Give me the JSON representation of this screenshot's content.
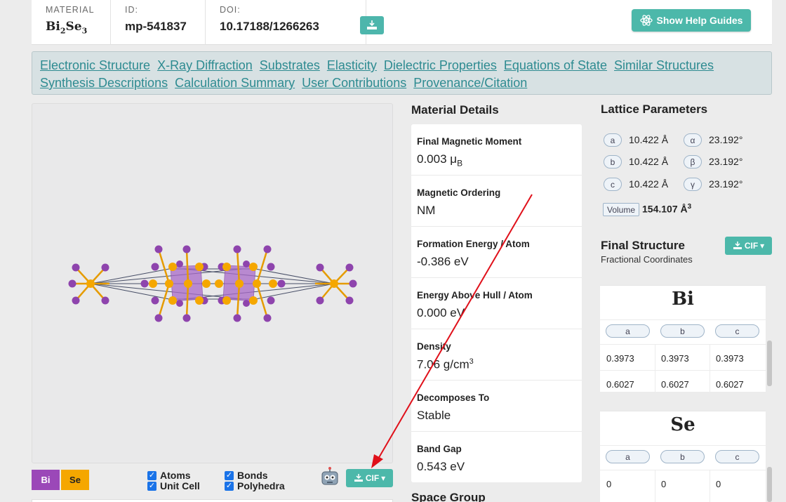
{
  "header": {
    "material_label": "MATERIAL",
    "formula_main": "Bi",
    "formula_sub1": "2",
    "formula_mid": "Se",
    "formula_sub2": "3",
    "id_label": "ID:",
    "id_value": "mp-541837",
    "doi_label": "DOI:",
    "doi_value": "10.17188/1266263",
    "help_label": "Show Help Guides"
  },
  "nav": {
    "links": [
      "Electronic Structure",
      "X-Ray Diffraction",
      "Substrates",
      "Elasticity",
      "Dielectric Properties",
      "Equations of State",
      "Similar Structures",
      "Synthesis Descriptions",
      "Calculation Summary",
      "User Contributions",
      "Provenance/Citation"
    ]
  },
  "viewer": {
    "elements": [
      {
        "label": "Bi",
        "color": "#9b48b8"
      },
      {
        "label": "Se",
        "color": "#f5a700"
      }
    ],
    "checks": {
      "atoms": "Atoms",
      "unit_cell": "Unit Cell",
      "bonds": "Bonds",
      "polyhedra": "Polyhedra"
    },
    "cif_label": "CIF"
  },
  "details": {
    "title": "Material Details",
    "rows": [
      {
        "label": "Final Magnetic Moment",
        "value": "0.003 μ",
        "sub": "B"
      },
      {
        "label": "Magnetic Ordering",
        "value": "NM"
      },
      {
        "label": "Formation Energy / Atom",
        "value": "-0.386 eV"
      },
      {
        "label": "Energy Above Hull / Atom",
        "value": "0.000 eV"
      },
      {
        "label": "Density",
        "value": "7.06 g/cm",
        "sup": "3"
      },
      {
        "label": "Decomposes To",
        "value": "Stable"
      },
      {
        "label": "Band Gap",
        "value": "0.543 eV"
      }
    ],
    "space_group_title": "Space Group"
  },
  "lattice": {
    "title": "Lattice Parameters",
    "params": [
      {
        "key": "a",
        "value": "10.422 Å"
      },
      {
        "key": "b",
        "value": "10.422 Å"
      },
      {
        "key": "c",
        "value": "10.422 Å"
      }
    ],
    "angles": [
      {
        "key": "α",
        "value": "23.192°"
      },
      {
        "key": "β",
        "value": "23.192°"
      },
      {
        "key": "γ",
        "value": "23.192°"
      }
    ],
    "volume_label": "Volume",
    "volume_value": "154.107 Å",
    "volume_sup": "3"
  },
  "final_structure": {
    "title": "Final Structure",
    "subtitle": "Fractional Coordinates",
    "cif_label": "CIF",
    "headers": [
      "a",
      "b",
      "c"
    ],
    "bi": {
      "element": "Bi",
      "rows": [
        [
          "0.3973",
          "0.3973",
          "0.3973"
        ],
        [
          "0.6027",
          "0.6027",
          "0.6027"
        ]
      ]
    },
    "se": {
      "element": "Se",
      "rows": [
        [
          "0",
          "0",
          "0"
        ]
      ]
    }
  },
  "colors": {
    "accent": "#4cb8aa",
    "link": "#2e8b91",
    "arrow": "#e0101a",
    "bi": "#9b48b8",
    "se": "#f5a700"
  }
}
